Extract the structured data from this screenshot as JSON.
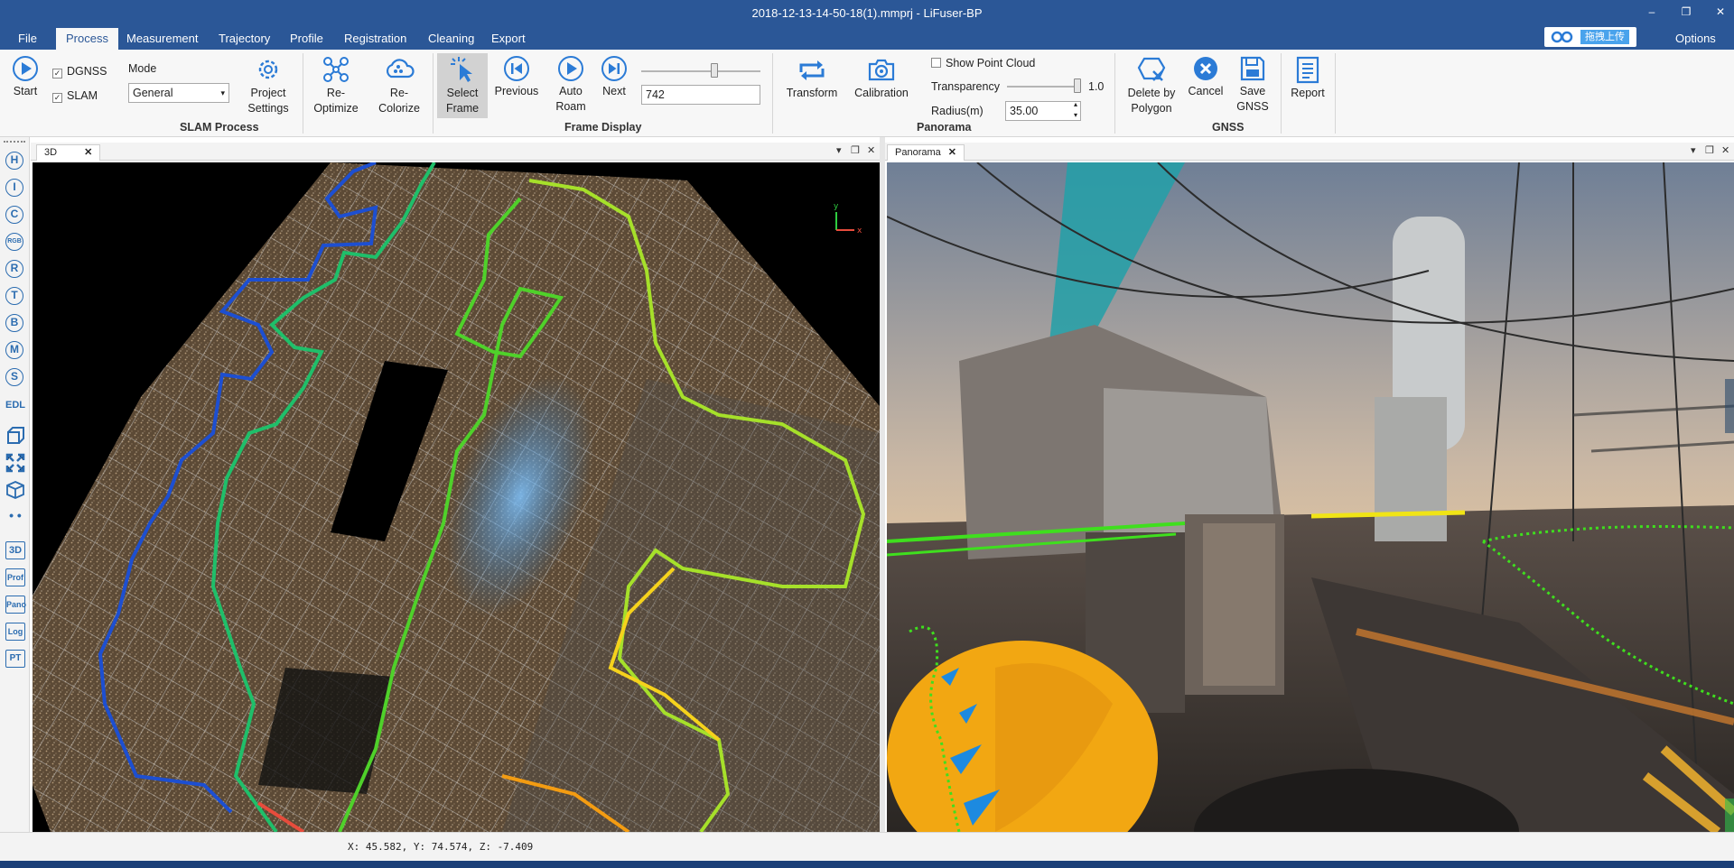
{
  "window": {
    "title": "2018-12-13-14-50-18(1).mmprj - LiFuser-BP",
    "minimize": "–",
    "maximize": "❐",
    "close": "✕"
  },
  "menu": {
    "items": [
      "File",
      "Process",
      "Measurement",
      "Trajectory",
      "Profile",
      "Registration",
      "Cleaning",
      "Export"
    ],
    "active": "Process",
    "cloud_label": "拖拽上传",
    "options": "Options"
  },
  "ribbon": {
    "start": "Start",
    "dgnss": "DGNSS",
    "slam": "SLAM",
    "mode_label": "Mode",
    "mode_value": "General",
    "project_settings": [
      "Project",
      "Settings"
    ],
    "reoptimize": [
      "Re-",
      "Optimize"
    ],
    "recolorize": [
      "Re-",
      "Colorize"
    ],
    "slam_group": "SLAM Process",
    "select_frame": [
      "Select",
      "Frame"
    ],
    "previous": "Previous",
    "auto_roam": [
      "Auto",
      "Roam"
    ],
    "next": "Next",
    "frame_value": "742",
    "frame_slider_fraction": 0.62,
    "frame_group": "Frame Display",
    "transform": "Transform",
    "calibration": "Calibration",
    "show_point_cloud": "Show Point Cloud",
    "transparency_label": "Transparency",
    "transparency_value": "1.0",
    "transparency_fraction": 1.0,
    "radius_label": "Radius(m)",
    "radius_value": "35.00",
    "panorama_group": "Panorama",
    "delete_by_polygon": [
      "Delete by",
      "Polygon"
    ],
    "cancel": "Cancel",
    "save_gnss": [
      "Save",
      "GNSS"
    ],
    "gnss_group": "GNSS",
    "report": "Report"
  },
  "left_tools": [
    "H",
    "I",
    "C",
    "RGB",
    "R",
    "T",
    "B",
    "M",
    "S",
    "EDL",
    "box",
    "expand",
    "cube",
    "dots",
    "3D",
    "Prof",
    "Pano",
    "Log",
    "PT"
  ],
  "panels": {
    "left_tab": "3D",
    "right_tab": "Panorama",
    "close_glyph": "✕",
    "menu_glyph": "▾",
    "float_glyph": "❐"
  },
  "status": {
    "coords": "X: 45.582, Y: 74.574, Z: -7.409"
  },
  "colors": {
    "accent": "#2b5797",
    "icon_blue": "#2b7bd6"
  }
}
